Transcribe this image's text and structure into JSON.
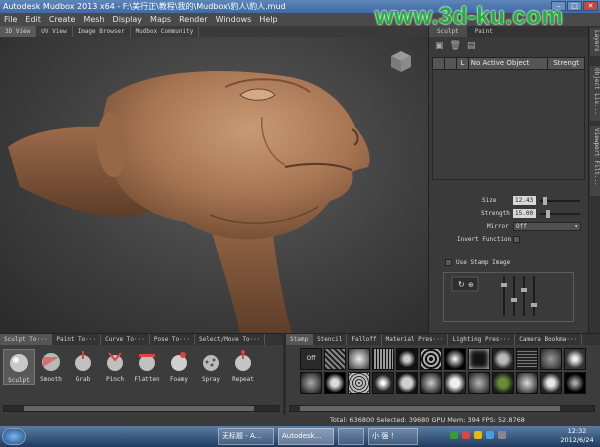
{
  "title_bar": {
    "title": "Autodesk Mudbox 2013 x64 - F:\\美行正\\教程\\我的\\Mudbox\\豹人\\豹人.mud",
    "minimize": "–",
    "maximize": "□",
    "close": "✕"
  },
  "watermark": "www.3d-ku.com",
  "menu": [
    "File",
    "Edit",
    "Create",
    "Mesh",
    "Display",
    "Maps",
    "Render",
    "Windows",
    "Help"
  ],
  "view_tabs": [
    "3D View",
    "UV View",
    "Image Browser",
    "Mudbox Community"
  ],
  "right_panel": {
    "tabs": [
      "Sculpt",
      "Paint"
    ],
    "layer": {
      "vis": "",
      "lock": "",
      "L": "L",
      "name": "No Active Object",
      "strength": "Strengt"
    },
    "properties": {
      "size_label": "Size",
      "size_value": "12.43",
      "strength_label": "Strength",
      "strength_value": "15.00",
      "mirror_label": "Mirror",
      "mirror_value": "Off",
      "invert_label": "Invert Function",
      "use_stamp_label": "Use Stamp Image"
    }
  },
  "side_tabs": [
    "Object Lis...",
    "Viewport Filt..."
  ],
  "side_tab_top": "Layers",
  "left_tray": {
    "tabs": [
      "Sculpt To···",
      "Paint To···",
      "Curve To···",
      "Pose To···",
      "Select/Move To···"
    ],
    "tools": [
      "Sculpt",
      "Smooth",
      "Grab",
      "Pinch",
      "Flatten",
      "Foamy",
      "Spray",
      "Repeat"
    ]
  },
  "right_tray": {
    "tabs": [
      "Stamp",
      "Stencil",
      "Falloff",
      "Material Pres···",
      "Lighting Pres···",
      "Camera Bookma···"
    ],
    "off_label": "Off"
  },
  "status": "Total: 636800  Selected: 39680  GPU Mem: 394  FPS: 52.8768",
  "taskbar": {
    "items": [
      "无标题 - A...",
      "Autodesk...",
      "",
      "小 强 ！"
    ],
    "time": "12:32",
    "date": "2012/6/24"
  },
  "colors": {
    "accent": "#4a9be0",
    "skin": "#b58561",
    "watermark": "#1db33a"
  }
}
